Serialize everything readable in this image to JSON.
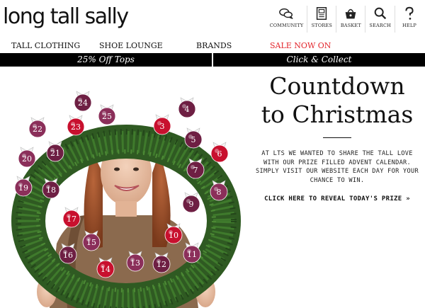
{
  "brand": {
    "logo_text": "long tall sally"
  },
  "utility_nav": [
    {
      "label": "COMMUNITY",
      "icon": "speech-bubbles-icon"
    },
    {
      "label": "STORES",
      "icon": "store-icon"
    },
    {
      "label": "BASKET",
      "icon": "basket-icon"
    },
    {
      "label": "SEARCH",
      "icon": "magnifier-icon"
    },
    {
      "label": "HELP",
      "icon": "question-mark-icon"
    }
  ],
  "main_nav": [
    {
      "label": "TALL CLOTHING"
    },
    {
      "label": "SHOE LOUNGE"
    },
    {
      "label": "BRANDS"
    },
    {
      "label": "SALE NOW ON",
      "color": "#e3242b"
    }
  ],
  "promo_bar": [
    {
      "label": "25% Off Tops"
    },
    {
      "label": "Click & Collect"
    }
  ],
  "hero": {
    "title_line1": "Countdown",
    "title_line2": "to Christmas",
    "body": "AT LTS WE WANTED TO SHARE THE TALL LOVE WITH OUR PRIZE FILLED ADVENT CALENDAR. SIMPLY VISIT OUR WEBSITE EACH DAY FOR YOUR CHANCE TO WIN.",
    "cta": "CLICK HERE TO REVEAL TODAY'S PRIZE »",
    "ornaments": [
      "24",
      "25",
      "4",
      "22",
      "23",
      "3",
      "5",
      "20",
      "21",
      "6",
      "7",
      "19",
      "18",
      "8",
      "9",
      "17",
      "10",
      "15",
      "16",
      "11",
      "14",
      "13",
      "12"
    ],
    "colors": {
      "wreath": "#2f5a22",
      "ornament_red": "#c8102e",
      "ornament_purple": "#8b2f5a",
      "ornament_plum": "#6e1f43"
    }
  }
}
